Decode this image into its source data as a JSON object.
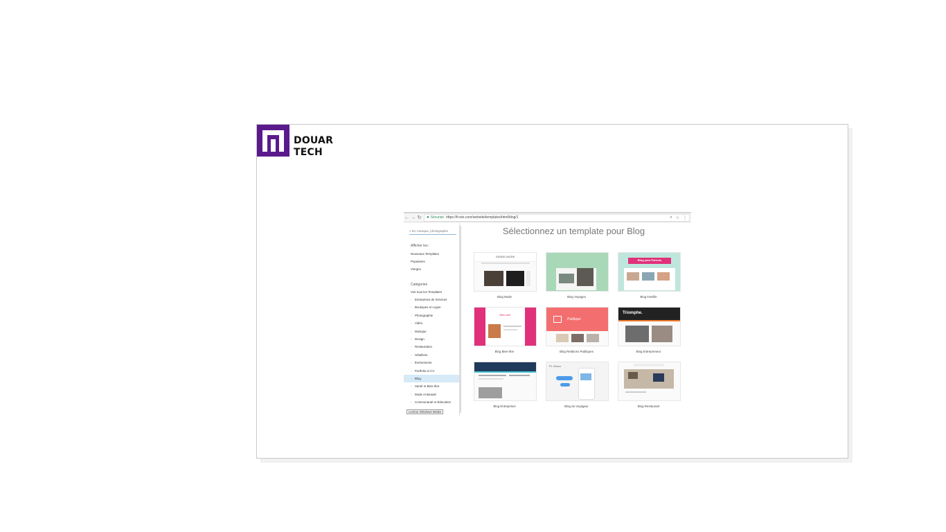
{
  "brand": {
    "line1": "DOUAR",
    "line2": "TECH",
    "color": "#5b1a8c"
  },
  "browser": {
    "secure_label": "Sécurisé",
    "url": "https://fr.wix.com/website/templates/html/blog/1"
  },
  "sidebar": {
    "search_placeholder": "Ex: musique, photographie",
    "show_title": "Afficher les :",
    "show_items": [
      "Nouveaux Templates",
      "Populaires",
      "Vierges"
    ],
    "categories_title": "Catégories",
    "all_templates": "Voir tous les Templates",
    "categories": [
      "Entreprises de Services",
      "Boutiques en Ligne",
      "Photographie",
      "Vidéo",
      "Musique",
      "Design",
      "Restauration",
      "Hôtellerie",
      "Événements",
      "Portfolio et CV",
      "Blog",
      "Santé et Bien-être",
      "Mode et Beauté",
      "Communauté et Éducation"
    ],
    "active_category": "Blog",
    "taskbar_tooltip": "Lecteur Windows Media"
  },
  "main": {
    "title": "Sélectionnez un template pour Blog",
    "templates": [
      {
        "caption": "Blog Mode",
        "header_text": "GRADE-MODE"
      },
      {
        "caption": "Blog Voyages",
        "header_text": ""
      },
      {
        "caption": "Blog Famille",
        "header_text": "Blog your Parents"
      },
      {
        "caption": "Blog Bien-être",
        "header_text": "Bien-être"
      },
      {
        "caption": "Blog Relations Publiques",
        "header_text": "Publique"
      },
      {
        "caption": "Blog Entrepreneur",
        "header_text": "Triomphe."
      },
      {
        "caption": "Blog Entreprises",
        "header_text": ""
      },
      {
        "caption": "Blog du Voyageur",
        "header_text": "Pr. Greco"
      },
      {
        "caption": "Blog Restaurant",
        "header_text": ""
      }
    ]
  },
  "colors": {
    "accent_pink": "#e0317a",
    "accent_coral": "#f36f6f",
    "accent_green": "#a9d8b8",
    "active_bg": "#d6eaf8"
  }
}
